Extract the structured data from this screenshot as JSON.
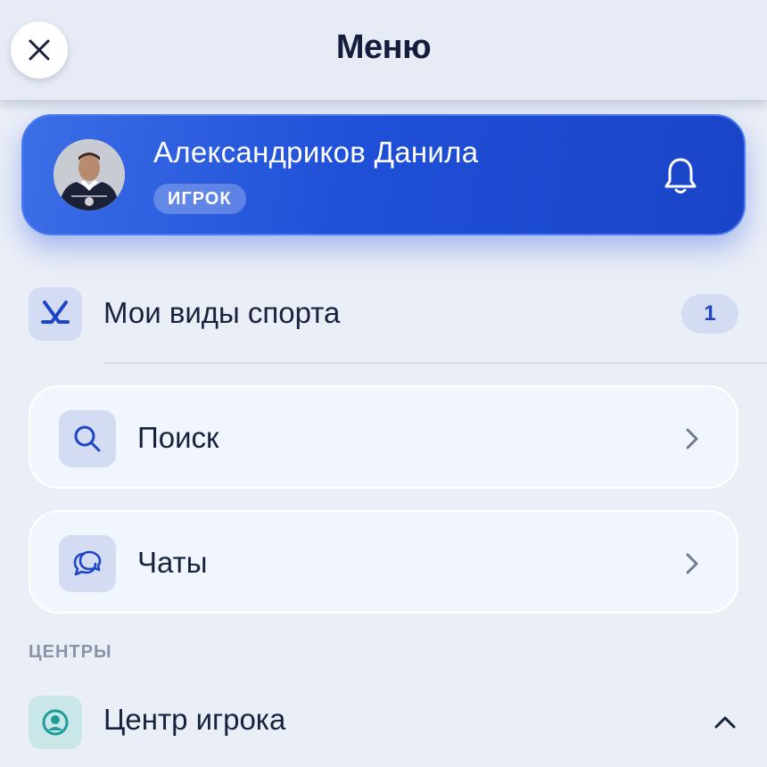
{
  "header": {
    "title": "Меню",
    "close_icon": "close-icon"
  },
  "profile": {
    "name": "Александриков Данила",
    "role": "ИГРОК",
    "avatar": "avatar-photo",
    "bell_icon": "bell-icon"
  },
  "sports": {
    "label": "Мои виды спорта",
    "count": "1",
    "icon": "hockey-sticks-icon"
  },
  "nav": [
    {
      "label": "Поиск",
      "icon": "search-icon"
    },
    {
      "label": "Чаты",
      "icon": "chat-bubbles-icon"
    }
  ],
  "centers": {
    "section_title": "ЦЕНТРЫ",
    "items": [
      {
        "label": "Центр игрока",
        "icon": "user-circle-icon",
        "expanded": true
      }
    ]
  },
  "colors": {
    "accent": "#1f50d8",
    "background": "#e9eef7",
    "text": "#17223d",
    "tile": "#d3dcf2",
    "tile_teal": "#c9e7e8"
  }
}
